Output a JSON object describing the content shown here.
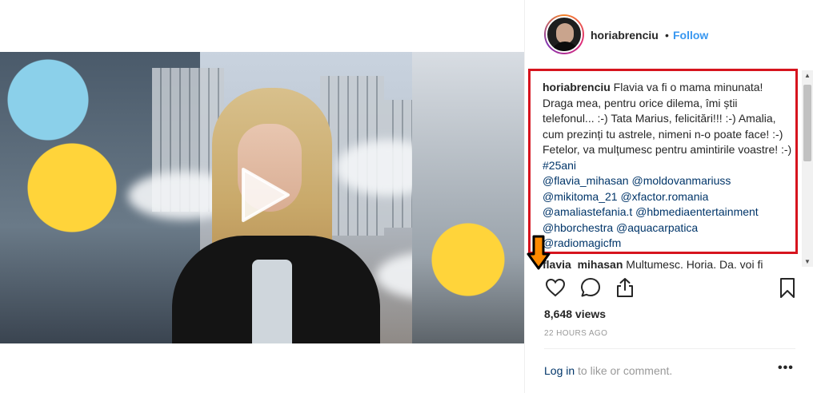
{
  "post": {
    "username": "horiabrenciu",
    "separator": "•",
    "follow_label": "Follow",
    "caption": {
      "username": "horiabrenciu",
      "text": " Flavia va fi o mama minunata! Draga mea, pentru orice dilema, îmi știi telefonul... :-) Tata Marius, felicitări!!! :-) Amalia, cum prezinți tu astrele, nimeni n-o poate face! :-) Fetelor, va mulțumesc pentru amintirile voastre! :-) ",
      "hashtag": "#25ani",
      "mentions": [
        "@flavia_mihasan",
        "@moldovanmariuss",
        "@mikitoma_21",
        "@xfactor.romania",
        "@amaliastefania.t",
        "@hbmediaentertainment",
        "@hborchestra",
        "@aquacarpatica",
        "@radiomagicfm"
      ]
    },
    "next_comment": {
      "username": "flavia_mihasan",
      "text": " Mulțumesc, Horia. Da, voi fi"
    },
    "views": "8,648 views",
    "timestamp": "22 HOURS AGO",
    "login_link": "Log in",
    "login_text": " to like or comment.",
    "more_label": "•••"
  },
  "icons": [
    "play-icon",
    "heart-icon",
    "comment-icon",
    "share-icon",
    "bookmark-icon",
    "down-arrow-icon"
  ],
  "colors": {
    "follow": "#3897f0",
    "highlight_box": "#d6141e",
    "link": "#003569",
    "muted": "#999999"
  }
}
